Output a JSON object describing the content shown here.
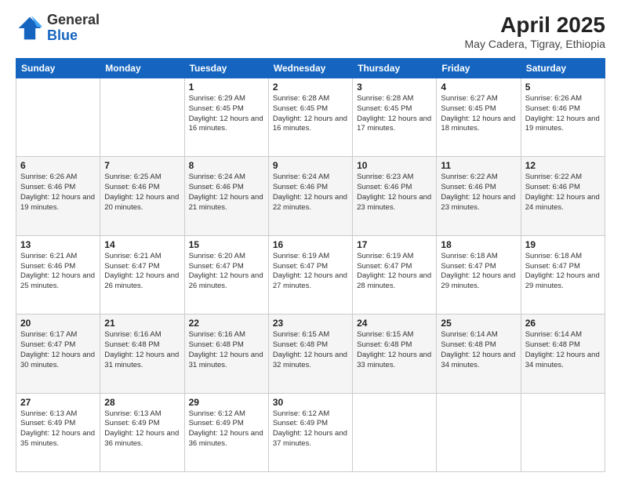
{
  "header": {
    "logo": {
      "general": "General",
      "blue": "Blue"
    },
    "title": "April 2025",
    "subtitle": "May Cadera, Tigray, Ethiopia"
  },
  "days_of_week": [
    "Sunday",
    "Monday",
    "Tuesday",
    "Wednesday",
    "Thursday",
    "Friday",
    "Saturday"
  ],
  "weeks": [
    [
      {
        "day": "",
        "info": ""
      },
      {
        "day": "",
        "info": ""
      },
      {
        "day": "1",
        "info": "Sunrise: 6:29 AM\nSunset: 6:45 PM\nDaylight: 12 hours and 16 minutes."
      },
      {
        "day": "2",
        "info": "Sunrise: 6:28 AM\nSunset: 6:45 PM\nDaylight: 12 hours and 16 minutes."
      },
      {
        "day": "3",
        "info": "Sunrise: 6:28 AM\nSunset: 6:45 PM\nDaylight: 12 hours and 17 minutes."
      },
      {
        "day": "4",
        "info": "Sunrise: 6:27 AM\nSunset: 6:45 PM\nDaylight: 12 hours and 18 minutes."
      },
      {
        "day": "5",
        "info": "Sunrise: 6:26 AM\nSunset: 6:46 PM\nDaylight: 12 hours and 19 minutes."
      }
    ],
    [
      {
        "day": "6",
        "info": "Sunrise: 6:26 AM\nSunset: 6:46 PM\nDaylight: 12 hours and 19 minutes."
      },
      {
        "day": "7",
        "info": "Sunrise: 6:25 AM\nSunset: 6:46 PM\nDaylight: 12 hours and 20 minutes."
      },
      {
        "day": "8",
        "info": "Sunrise: 6:24 AM\nSunset: 6:46 PM\nDaylight: 12 hours and 21 minutes."
      },
      {
        "day": "9",
        "info": "Sunrise: 6:24 AM\nSunset: 6:46 PM\nDaylight: 12 hours and 22 minutes."
      },
      {
        "day": "10",
        "info": "Sunrise: 6:23 AM\nSunset: 6:46 PM\nDaylight: 12 hours and 23 minutes."
      },
      {
        "day": "11",
        "info": "Sunrise: 6:22 AM\nSunset: 6:46 PM\nDaylight: 12 hours and 23 minutes."
      },
      {
        "day": "12",
        "info": "Sunrise: 6:22 AM\nSunset: 6:46 PM\nDaylight: 12 hours and 24 minutes."
      }
    ],
    [
      {
        "day": "13",
        "info": "Sunrise: 6:21 AM\nSunset: 6:46 PM\nDaylight: 12 hours and 25 minutes."
      },
      {
        "day": "14",
        "info": "Sunrise: 6:21 AM\nSunset: 6:47 PM\nDaylight: 12 hours and 26 minutes."
      },
      {
        "day": "15",
        "info": "Sunrise: 6:20 AM\nSunset: 6:47 PM\nDaylight: 12 hours and 26 minutes."
      },
      {
        "day": "16",
        "info": "Sunrise: 6:19 AM\nSunset: 6:47 PM\nDaylight: 12 hours and 27 minutes."
      },
      {
        "day": "17",
        "info": "Sunrise: 6:19 AM\nSunset: 6:47 PM\nDaylight: 12 hours and 28 minutes."
      },
      {
        "day": "18",
        "info": "Sunrise: 6:18 AM\nSunset: 6:47 PM\nDaylight: 12 hours and 29 minutes."
      },
      {
        "day": "19",
        "info": "Sunrise: 6:18 AM\nSunset: 6:47 PM\nDaylight: 12 hours and 29 minutes."
      }
    ],
    [
      {
        "day": "20",
        "info": "Sunrise: 6:17 AM\nSunset: 6:47 PM\nDaylight: 12 hours and 30 minutes."
      },
      {
        "day": "21",
        "info": "Sunrise: 6:16 AM\nSunset: 6:48 PM\nDaylight: 12 hours and 31 minutes."
      },
      {
        "day": "22",
        "info": "Sunrise: 6:16 AM\nSunset: 6:48 PM\nDaylight: 12 hours and 31 minutes."
      },
      {
        "day": "23",
        "info": "Sunrise: 6:15 AM\nSunset: 6:48 PM\nDaylight: 12 hours and 32 minutes."
      },
      {
        "day": "24",
        "info": "Sunrise: 6:15 AM\nSunset: 6:48 PM\nDaylight: 12 hours and 33 minutes."
      },
      {
        "day": "25",
        "info": "Sunrise: 6:14 AM\nSunset: 6:48 PM\nDaylight: 12 hours and 34 minutes."
      },
      {
        "day": "26",
        "info": "Sunrise: 6:14 AM\nSunset: 6:48 PM\nDaylight: 12 hours and 34 minutes."
      }
    ],
    [
      {
        "day": "27",
        "info": "Sunrise: 6:13 AM\nSunset: 6:49 PM\nDaylight: 12 hours and 35 minutes."
      },
      {
        "day": "28",
        "info": "Sunrise: 6:13 AM\nSunset: 6:49 PM\nDaylight: 12 hours and 36 minutes."
      },
      {
        "day": "29",
        "info": "Sunrise: 6:12 AM\nSunset: 6:49 PM\nDaylight: 12 hours and 36 minutes."
      },
      {
        "day": "30",
        "info": "Sunrise: 6:12 AM\nSunset: 6:49 PM\nDaylight: 12 hours and 37 minutes."
      },
      {
        "day": "",
        "info": ""
      },
      {
        "day": "",
        "info": ""
      },
      {
        "day": "",
        "info": ""
      }
    ]
  ]
}
